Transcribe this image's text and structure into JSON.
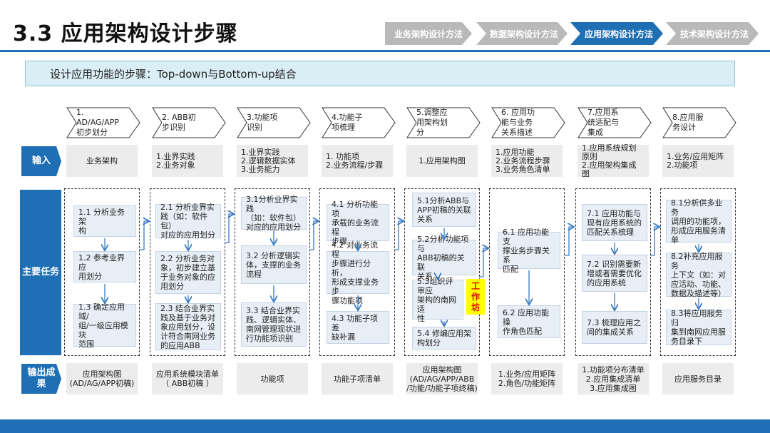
{
  "title": "3.3 应用架构设计步骤",
  "nav_tabs": [
    {
      "label": "业务架构设计方法",
      "active": false
    },
    {
      "label": "数据架构设计方法",
      "active": false
    },
    {
      "label": "应用架构设计方法",
      "active": true
    },
    {
      "label": "技术架构设计方法",
      "active": false
    }
  ],
  "subtitle": "设计应用功能的步骤：Top-down与Bottom-up结合",
  "row_labels": {
    "input": "输入",
    "tasks": "主要任务",
    "output": "输出成\n果"
  },
  "steps": [
    "1. AD/AG/APP\n初步划分",
    "2. ABB初\n步识别",
    "3.功能项\n识别",
    "4.功能子\n项梳理",
    "5.调整应\n用架构划\n分",
    "6. 应用功\n能与业务\n关系描述",
    "7.应用系\n统适配与\n集成",
    "8.应用服\n务设计"
  ],
  "inputs": [
    "业务架构",
    "1.业界实践\n2.业务对象",
    "1.业界实践\n2.逻辑数据实体\n3.业务能力",
    "1. 功能项\n2.业务流程/步骤",
    "1.应用架构图",
    "1.应用功能\n2.业务流程步骤\n3.业务角色清单",
    "1.应用系统规划\n原则\n2.应用架构集成\n图",
    "1.业务/应用矩阵\n2.功能项"
  ],
  "tasks": [
    [
      "1.1 分析业务架\n构",
      "1.2 参考业界应\n用划分",
      "1.3 确定应用域/\n组/一级应用模块\n范围"
    ],
    [
      "2.1 分析业界实\n践（如：软件包）\n对应的应用划分",
      "2.2 分析业务对\n象，初步建立基\n于业务对象的应\n用划分",
      "2.3 结合业界实\n践及基于业务对\n象应用划分，设\n计符合南网业务\n的应用ABB"
    ],
    [
      "3.1分析业界实践\n（如：软件包）\n对应的应用划分",
      "3.2 分析逻辑实\n体，支撑的业务\n流程",
      "3.3 结合业界实\n践、逻辑实体、\n南网管理现状进\n行功能项识别"
    ],
    [
      "4.1 分析功能项\n承载的业务流程\n步骤",
      "4.2 对业务流程\n步骤进行分析，\n形成支撑业务步\n骤功能项",
      "4.3 功能子项差\n缺补漏"
    ],
    [
      "5.1分析ABB与\nAPP初稿的关联\n关系",
      "5.2分析功能项与\nABB初稿的关联\n关系",
      "5.3组织评审应\n架构的南网适\n性",
      "5.4 修编应用架\n构划分"
    ],
    [
      "6.1 应用功能支\n撑业务步骤关系\n匹配",
      "6.2 应用功能操\n作角色匹配"
    ],
    [
      "7.1 应用功能与\n现有应用系统的\n匹配关系梳理",
      "7.2 识别需要新\n增或者需要优化\n的应用系统",
      "7.3 梳理应用之\n间的集成关系"
    ],
    [
      "8.1分析供多业务\n调用的功能项，\n形成应用服务清\n单",
      "8.2补充应用服务\n上下文（如：对\n应活动、功能、\n数据及描述等）",
      "8.3将应用服务归\n集到南网应用服\n务目录下"
    ]
  ],
  "workshop_label": "工\n作\n坊",
  "outputs": [
    "应用架构图\n(AD/AG/APP初稿)",
    "应用系统模块清单\n（ ABB初稿 ）",
    "功能项",
    "功能子项清单",
    "应用架构图\n(AD/AG/APP/ABB\n/功能/功能子项终稿)",
    "1.业务/应用矩阵\n2.角色/功能矩阵",
    "1.功能项分布清单\n2.应用集成清单\n3.应用集成图",
    "应用服务目录"
  ],
  "colors": {
    "accent": "#1f6fb5",
    "tab_inactive": "#b9b9b9",
    "subtitle_bg": "#daeef5",
    "cell_bg": "#ececec",
    "task_bg": "#e8eef6",
    "workshop_bg": "#ffff00",
    "workshop_text": "#e00000"
  }
}
